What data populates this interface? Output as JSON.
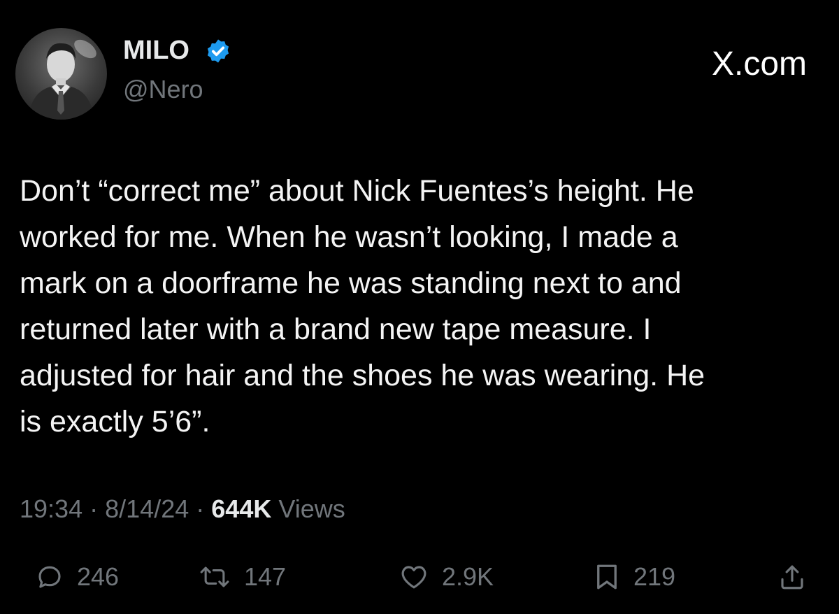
{
  "author": {
    "display_name": "MILO",
    "handle": "@Nero",
    "verified": true,
    "verified_color": "#1d9bf0"
  },
  "brand": {
    "label": "X.com"
  },
  "tweet": {
    "text": "Don’t “correct me” about Nick Fuentes’s height. He\nworked for me. When he wasn’t looking, I made a\nmark on a doorframe he was standing next to and\nreturned later with a brand new tape measure. I\nadjusted for hair and the shoes he was wearing. He\nis exactly 5’6”.",
    "time": "19:34",
    "date": "8/14/24",
    "separator": "·",
    "views_count": "644K",
    "views_label": "Views"
  },
  "actions": {
    "reply": {
      "icon": "reply-icon",
      "count": "246"
    },
    "repost": {
      "icon": "repost-icon",
      "count": "147"
    },
    "like": {
      "icon": "heart-icon",
      "count": "2.9K"
    },
    "bookmark": {
      "icon": "bookmark-icon",
      "count": "219"
    },
    "share": {
      "icon": "share-icon"
    }
  },
  "colors": {
    "background": "#000000",
    "text": "#e7e9ea",
    "secondary": "#71767b"
  }
}
